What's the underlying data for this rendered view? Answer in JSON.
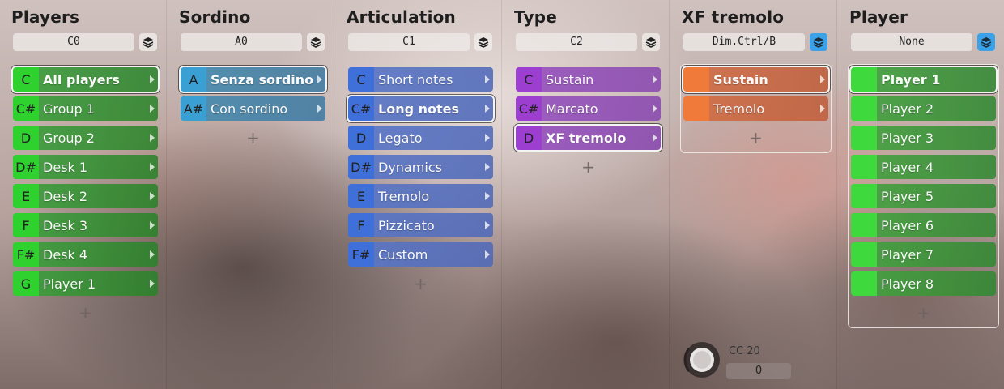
{
  "columns": [
    {
      "title": "Players",
      "note": "C0",
      "items": [
        {
          "key": "C",
          "label": "All players"
        },
        {
          "key": "C#",
          "label": "Group 1"
        },
        {
          "key": "D",
          "label": "Group 2"
        },
        {
          "key": "D#",
          "label": "Desk 1"
        },
        {
          "key": "E",
          "label": "Desk 2"
        },
        {
          "key": "F",
          "label": "Desk 3"
        },
        {
          "key": "F#",
          "label": "Desk 4"
        },
        {
          "key": "G",
          "label": "Player 1"
        }
      ],
      "add": "+"
    },
    {
      "title": "Sordino",
      "note": "A0",
      "items": [
        {
          "key": "A",
          "label": "Senza sordino"
        },
        {
          "key": "A#",
          "label": "Con sordino"
        }
      ],
      "add": "+"
    },
    {
      "title": "Articulation",
      "note": "C1",
      "items": [
        {
          "key": "C",
          "label": "Short notes"
        },
        {
          "key": "C#",
          "label": "Long notes"
        },
        {
          "key": "D",
          "label": "Legato"
        },
        {
          "key": "D#",
          "label": "Dynamics"
        },
        {
          "key": "E",
          "label": "Tremolo"
        },
        {
          "key": "F",
          "label": "Pizzicato"
        },
        {
          "key": "F#",
          "label": "Custom"
        }
      ],
      "add": "+"
    },
    {
      "title": "Type",
      "note": "C2",
      "items": [
        {
          "key": "C",
          "label": "Sustain"
        },
        {
          "key": "C#",
          "label": "Marcato"
        },
        {
          "key": "D",
          "label": "XF tremolo"
        }
      ],
      "add": "+"
    },
    {
      "title": "XF tremolo",
      "note": "Dim.Ctrl/B",
      "items": [
        {
          "key": "",
          "label": "Sustain"
        },
        {
          "key": "",
          "label": "Tremolo"
        }
      ],
      "add": "+"
    },
    {
      "title": "Player",
      "note": "None",
      "items": [
        {
          "key": "",
          "label": "Player 1"
        },
        {
          "key": "",
          "label": "Player 2"
        },
        {
          "key": "",
          "label": "Player 3"
        },
        {
          "key": "",
          "label": "Player 4"
        },
        {
          "key": "",
          "label": "Player 5"
        },
        {
          "key": "",
          "label": "Player 6"
        },
        {
          "key": "",
          "label": "Player 7"
        },
        {
          "key": "",
          "label": "Player 8"
        }
      ],
      "add": "+"
    }
  ],
  "cc": {
    "label": "CC 20",
    "value": "0"
  },
  "icons": {
    "layers": "layers-icon",
    "arrow": "chevron-right-icon",
    "knob": "knob-icon"
  },
  "colors": {
    "layer_active": "#3ba2e8"
  }
}
